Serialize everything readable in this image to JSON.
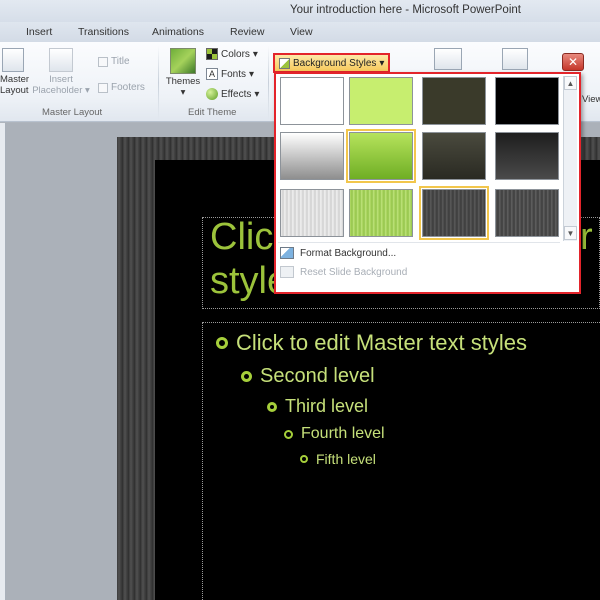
{
  "window": {
    "title": "Your introduction here - Microsoft PowerPoint"
  },
  "tabs": [
    "Insert",
    "Transitions",
    "Animations",
    "Review",
    "View"
  ],
  "ribbon": {
    "master_layout": {
      "master_label_1": "Master",
      "master_label_2": "Layout",
      "insert_label_1": "Insert",
      "insert_label_2": "Placeholder",
      "title_checkbox": "Title",
      "footers_checkbox": "Footers",
      "group_label": "Master Layout"
    },
    "edit_theme": {
      "themes_label": "Themes",
      "colors_label": "Colors",
      "fonts_label": "Fonts",
      "effects_label": "Effects",
      "group_label": "Edit Theme"
    },
    "background": {
      "styles_button": "Background Styles"
    },
    "right_edge_label": "View",
    "close_glyph": "✕"
  },
  "gallery": {
    "menu_items": {
      "format_background": "Format Background...",
      "reset_background": "Reset Slide Background"
    }
  },
  "slide": {
    "title": "Click\nstyle",
    "title_right_fragment": "r",
    "levels": [
      "Click to edit Master text styles",
      "Second level",
      "Third level",
      "Fourth level",
      "Fifth level"
    ]
  },
  "colors": {
    "accent_green": "#9cc33b",
    "highlight_red": "#e3242b",
    "selected_outline": "#f2c64c"
  }
}
